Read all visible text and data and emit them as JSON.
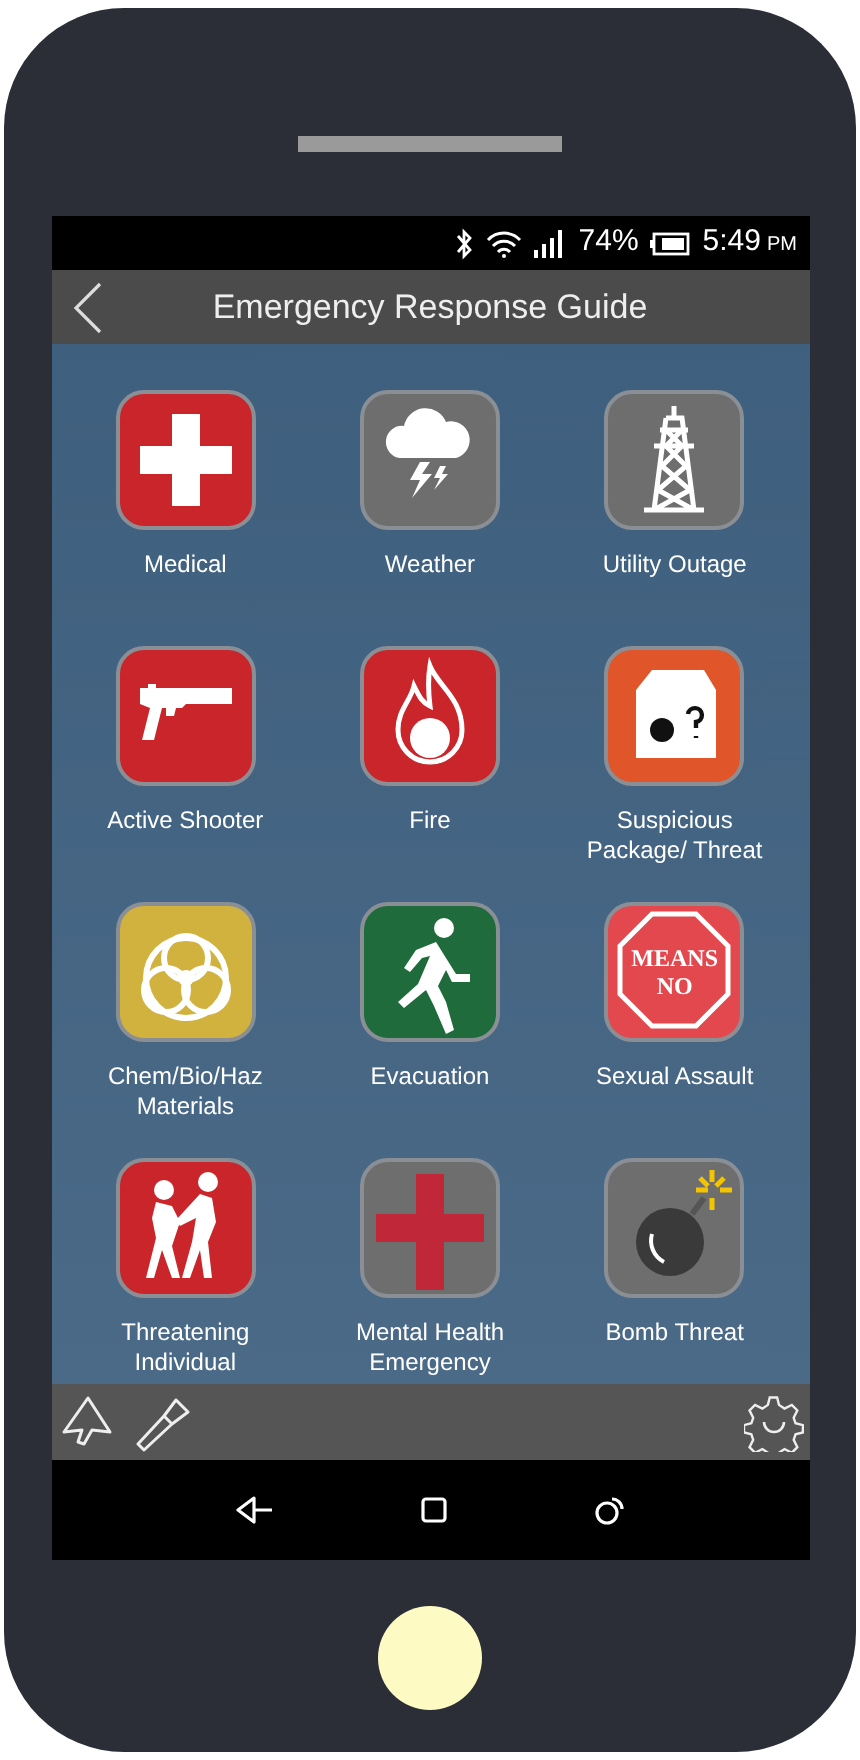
{
  "status_bar": {
    "battery": "74%",
    "time": "5:49",
    "meridiem": "PM"
  },
  "title_bar": {
    "title": "Emergency Response Guide"
  },
  "tiles": [
    {
      "label": "Medical",
      "kind": "cross",
      "color": "#c9252a"
    },
    {
      "label": "Weather",
      "kind": "storm",
      "color": "#6e6e6e"
    },
    {
      "label": "Utility Outage",
      "kind": "tower",
      "color": "#6e6e6e"
    },
    {
      "label": "Active Shooter",
      "kind": "gun",
      "color": "#c9252a"
    },
    {
      "label": "Fire",
      "kind": "fire",
      "color": "#c9252a"
    },
    {
      "label": "Suspicious Package/ Threat",
      "kind": "package",
      "color": "#e0562a"
    },
    {
      "label": "Chem/Bio/Haz Materials",
      "kind": "biohazard",
      "color": "#d1b23e"
    },
    {
      "label": "Evacuation",
      "kind": "exit",
      "color": "#1f6b3b"
    },
    {
      "label": "Sexual Assault",
      "kind": "stop",
      "color": "#e2484d"
    },
    {
      "label": "Threatening Individual",
      "kind": "fight",
      "color": "#c9252a"
    },
    {
      "label": "Mental Health Emergency",
      "kind": "redcross",
      "color": "#6e6e6e"
    },
    {
      "label": "Bomb Threat",
      "kind": "bomb",
      "color": "#6e6e6e"
    }
  ],
  "stop_sign_icon": {
    "lines": [
      "MEANS",
      "NO"
    ]
  }
}
